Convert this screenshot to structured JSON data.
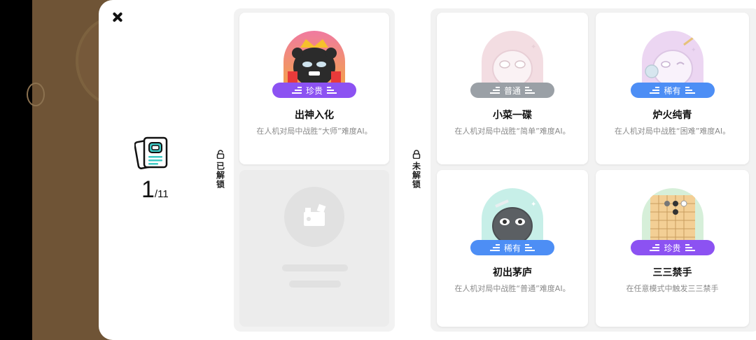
{
  "summary": {
    "unlocked": "1",
    "total": "/11"
  },
  "unlocked_section": {
    "label": "已解锁"
  },
  "locked_section": {
    "label": "未解锁"
  },
  "cards": [
    {
      "title": "出神入化",
      "desc": "在人机对局中战胜“大师”难度AI。",
      "rarity": "珍贵",
      "rarity_color": "#8c52f2"
    },
    {
      "title": "小菜一碟",
      "desc": "在人机对局中战胜“简单”难度AI。",
      "rarity": "普通",
      "rarity_color": "#9aa0a6"
    },
    {
      "title": "炉火纯青",
      "desc": "在人机对局中战胜“困难”难度AI。",
      "rarity": "稀有",
      "rarity_color": "#4d8ef5"
    },
    {
      "title": "初出茅庐",
      "desc": "在人机对局中战胜“普通”难度AI。",
      "rarity": "稀有",
      "rarity_color": "#4d8ef5"
    },
    {
      "title": "三三禁手",
      "desc": "在任意模式中触发三三禁手",
      "rarity": "珍贵",
      "rarity_color": "#8c52f2"
    }
  ]
}
